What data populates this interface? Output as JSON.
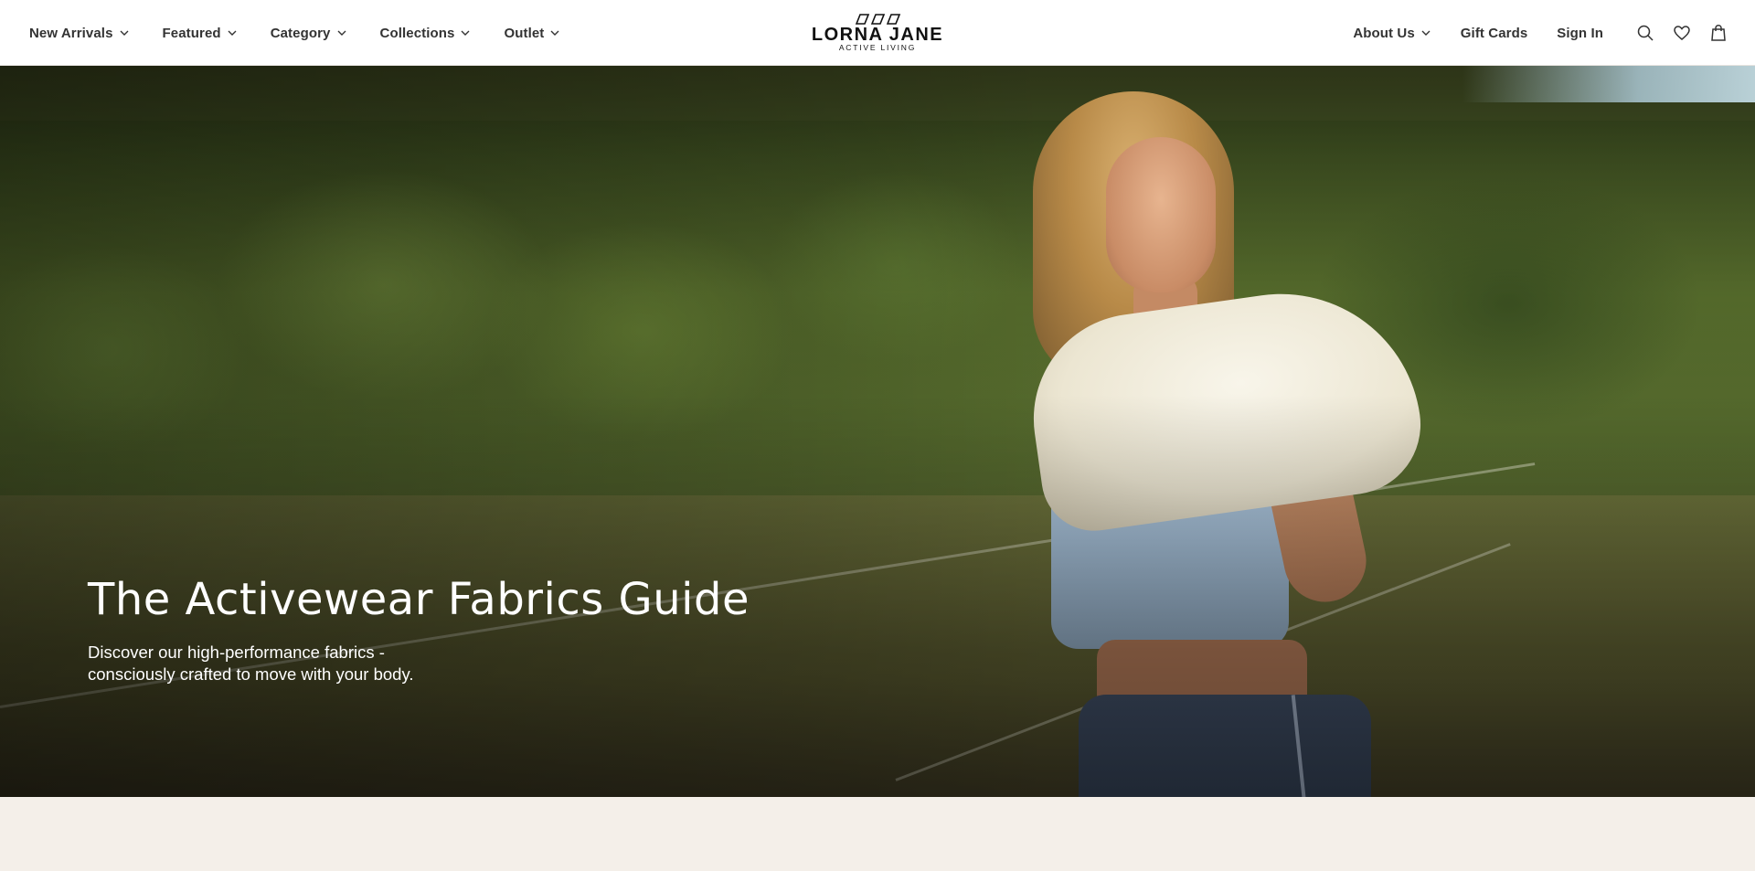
{
  "header": {
    "nav_left": [
      {
        "label": "New Arrivals",
        "has_dropdown": true
      },
      {
        "label": "Featured",
        "has_dropdown": true
      },
      {
        "label": "Category",
        "has_dropdown": true
      },
      {
        "label": "Collections",
        "has_dropdown": true
      },
      {
        "label": "Outlet",
        "has_dropdown": true
      }
    ],
    "logo": {
      "wordmark": "LORNA JANE",
      "tagline": "ACTIVE LIVING"
    },
    "nav_right": {
      "about_label": "About Us",
      "gift_cards_label": "Gift Cards",
      "sign_in_label": "Sign In"
    },
    "icons": [
      "search-icon",
      "heart-icon",
      "bag-icon"
    ]
  },
  "hero": {
    "title": "The Activewear Fabrics Guide",
    "subtitle": "Discover our high-performance fabrics - consciously crafted to move with your body."
  },
  "colors": {
    "header_bg": "#ffffff",
    "nav_text": "#333333",
    "hero_text": "#ffffff",
    "page_bg": "#f4efe9"
  }
}
